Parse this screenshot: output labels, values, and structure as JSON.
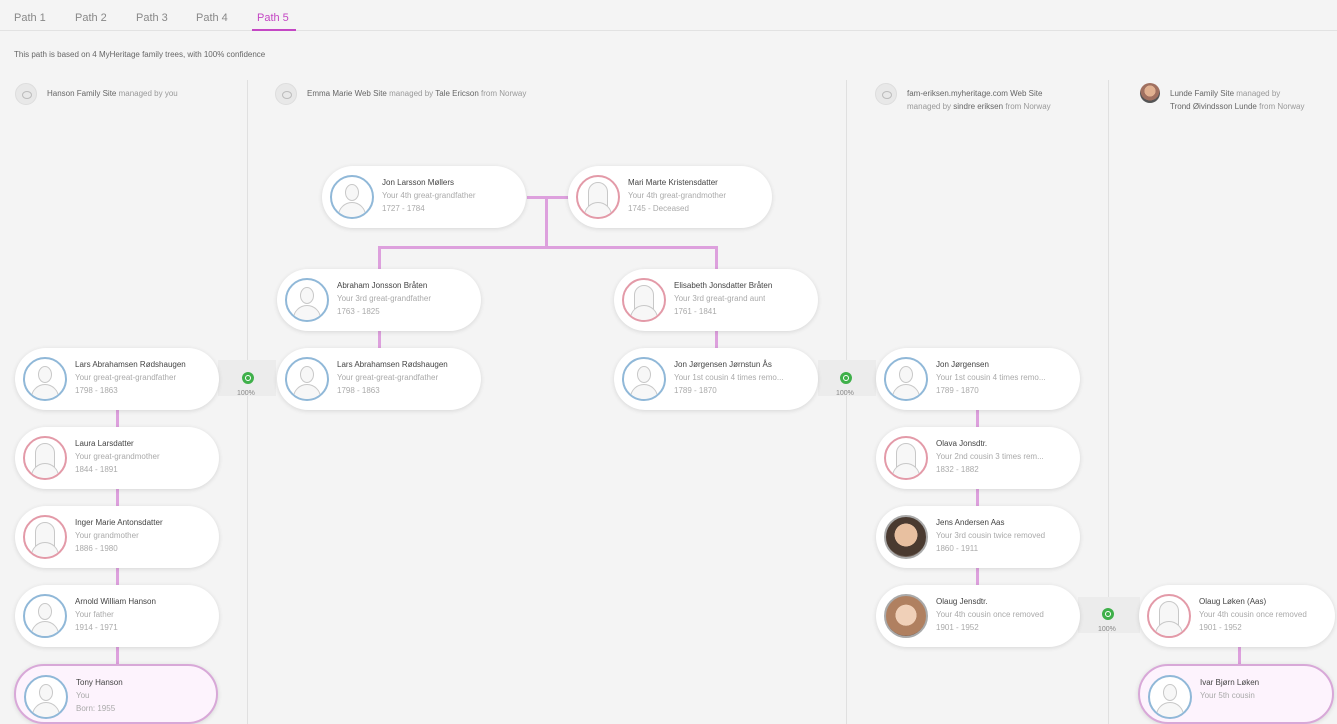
{
  "tabs": [
    {
      "label": "Path 1"
    },
    {
      "label": "Path 2"
    },
    {
      "label": "Path 3"
    },
    {
      "label": "Path 4"
    },
    {
      "label": "Path 5"
    }
  ],
  "active_tab": "Path 5",
  "confidence_text": "This path is based on 4 MyHeritage family trees, with 100% confidence",
  "sites": [
    {
      "name": "Hanson Family Site",
      "managed": "managed by you",
      "icon": "eye-icon"
    },
    {
      "name": "Emma Marie Web Site",
      "managed": "managed by",
      "manager": "Tale Ericson",
      "from": "from Norway",
      "icon": "eye-icon"
    },
    {
      "name": "fam-eriksen.myheritage.com Web Site",
      "managed": "managed by",
      "manager": "sindre eriksen",
      "from": "from Norway",
      "icon": "eye-icon"
    },
    {
      "name": "Lunde Family Site",
      "managed": "managed by",
      "manager": "Trond Øivindsson Lunde",
      "from": "from Norway",
      "icon": "owner-photo"
    }
  ],
  "people": [
    {
      "name": "Jon Larsson Møllers",
      "rel": "Your 4th great-grandfather",
      "dates": "1727 - 1784",
      "gender": "male"
    },
    {
      "name": "Mari Marte Kristensdatter",
      "rel": "Your 4th great-grandmother",
      "dates": "1745 - Deceased",
      "gender": "female"
    },
    {
      "name": "Abraham Jonsson Bråten",
      "rel": "Your 3rd great-grandfather",
      "dates": "1763 - 1825",
      "gender": "male"
    },
    {
      "name": "Elisabeth Jonsdatter Bråten",
      "rel": "Your 3rd great-grand aunt",
      "dates": "1761 - 1841",
      "gender": "female"
    },
    {
      "name": "Lars Abrahamsen Rødshaugen",
      "rel": "Your great-great-grandfather",
      "dates": "1798 - 1863",
      "gender": "male"
    },
    {
      "name": "Lars Abrahamsen Rødshaugen",
      "rel": "Your great-great-grandfather",
      "dates": "1798 - 1863",
      "gender": "male"
    },
    {
      "name": "Jon Jørgensen Jørnstun Ås",
      "rel": "Your 1st cousin 4 times remo...",
      "dates": "1789 - 1870",
      "gender": "male"
    },
    {
      "name": "Jon Jørgensen",
      "rel": "Your 1st cousin 4 times remo...",
      "dates": "1789 - 1870",
      "gender": "male"
    },
    {
      "name": "Laura Larsdatter",
      "rel": "Your great-grandmother",
      "dates": "1844 - 1891",
      "gender": "female"
    },
    {
      "name": "Olava Jonsdtr.",
      "rel": "Your 2nd cousin 3 times rem...",
      "dates": "1832 - 1882",
      "gender": "female"
    },
    {
      "name": "Inger Marie Antonsdatter",
      "rel": "Your grandmother",
      "dates": "1886 - 1980",
      "gender": "female"
    },
    {
      "name": "Jens Andersen Aas",
      "rel": "Your 3rd cousin twice removed",
      "dates": "1860 - 1911",
      "gender": "photo"
    },
    {
      "name": "Arnold William Hanson",
      "rel": "Your father",
      "dates": "1914 - 1971",
      "gender": "male"
    },
    {
      "name": "Olaug Jensdtr.",
      "rel": "Your 4th cousin once removed",
      "dates": "1901 - 1952",
      "gender": "photo2"
    },
    {
      "name": "Olaug Løken (Aas)",
      "rel": "Your 4th cousin once removed",
      "dates": "1901 - 1952",
      "gender": "female"
    },
    {
      "name": "Tony Hanson",
      "rel": "You",
      "dates": "Born: 1955",
      "gender": "male"
    },
    {
      "name": "Ivar Bjørn Løken",
      "rel": "Your 5th cousin",
      "dates": "",
      "gender": "male"
    }
  ],
  "matches": [
    {
      "pct": "100%"
    },
    {
      "pct": "100%"
    },
    {
      "pct": "100%"
    }
  ],
  "colors": {
    "accent": "#c447c4",
    "line": "#dda0dd",
    "match": "#3fb04a"
  }
}
